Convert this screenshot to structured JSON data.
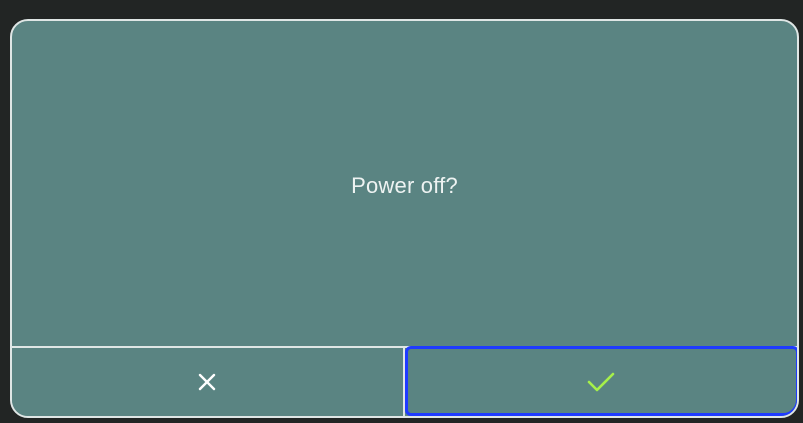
{
  "dialog": {
    "message": "Power off?",
    "buttons": {
      "cancel": {
        "icon": "close-icon",
        "color": "#ffffff"
      },
      "confirm": {
        "icon": "checkmark-icon",
        "color": "#a6f04a",
        "focused": true
      }
    }
  },
  "colors": {
    "dialog_background": "#5a8482",
    "border": "#dfe6e5",
    "focus_ring": "#1f3bff"
  }
}
